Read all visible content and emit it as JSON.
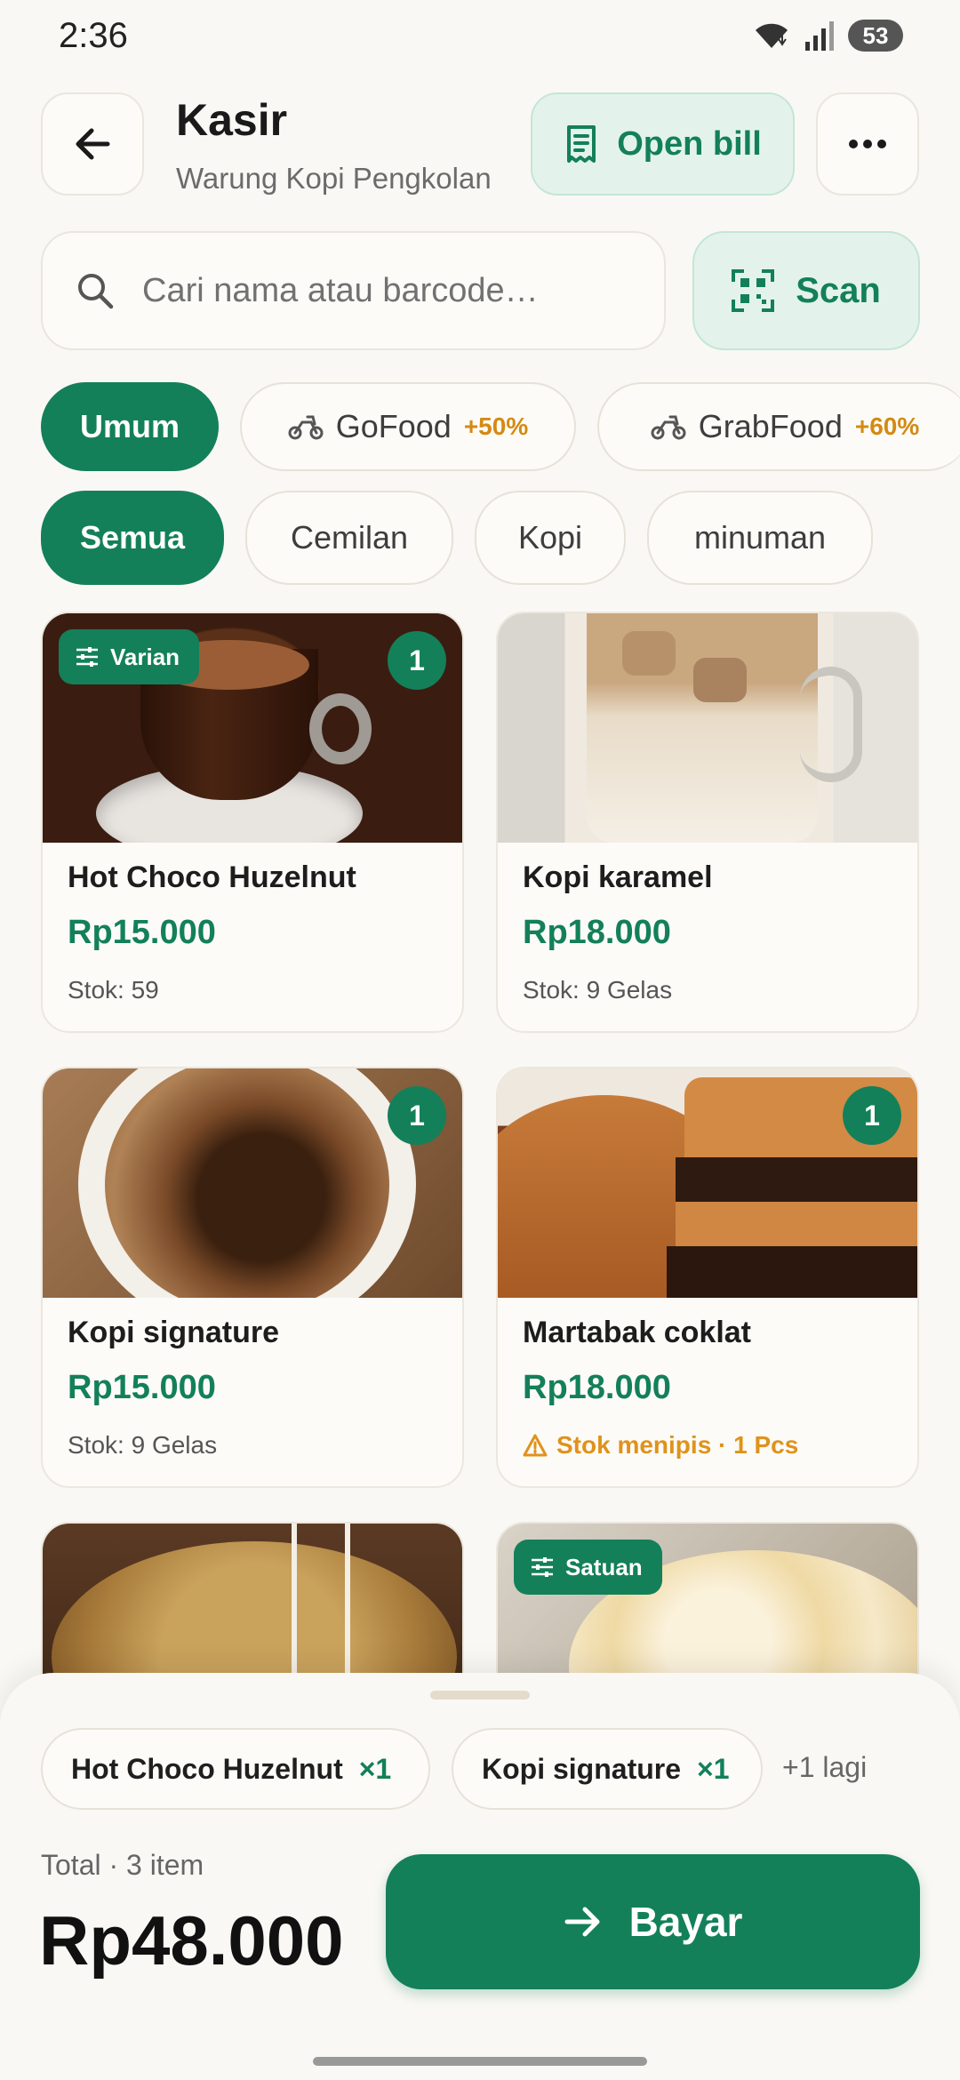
{
  "status_bar": {
    "time": "2:36",
    "battery": "53"
  },
  "header": {
    "title": "Kasir",
    "subtitle": "Warung Kopi Pengkolan",
    "open_bill_label": "Open bill"
  },
  "search": {
    "placeholder": "Cari nama atau barcode…",
    "scan_label": "Scan"
  },
  "channels": [
    {
      "label": "Umum",
      "active": true
    },
    {
      "label": "GoFood",
      "markup": "+50%"
    },
    {
      "label": "GrabFood",
      "markup": "+60%"
    }
  ],
  "categories": [
    {
      "label": "Semua",
      "active": true
    },
    {
      "label": "Cemilan"
    },
    {
      "label": "Kopi"
    },
    {
      "label": "minuman"
    }
  ],
  "products": [
    {
      "name": "Hot Choco Huzelnut",
      "price": "Rp15.000",
      "stock": "Stok: 59",
      "qty": "1",
      "badge": "Varian"
    },
    {
      "name": "Kopi karamel",
      "price": "Rp18.000",
      "stock": "Stok: 9 Gelas"
    },
    {
      "name": "Kopi signature",
      "price": "Rp15.000",
      "stock": "Stok: 9 Gelas",
      "qty": "1"
    },
    {
      "name": "Martabak coklat",
      "price": "Rp18.000",
      "stock": "Stok menipis · 1 Pcs",
      "qty": "1"
    },
    {
      "name": "",
      "price": "",
      "stock": ""
    },
    {
      "name": "",
      "price": "",
      "stock": "",
      "badge": "Satuan"
    }
  ],
  "cart": {
    "items": [
      {
        "name": "Hot Choco Huzelnut",
        "qty": "×1"
      },
      {
        "name": "Kopi signature",
        "qty": "×1"
      }
    ],
    "more": "+1 lagi",
    "total_label": "Total · 3 item",
    "total_value": "Rp48.000",
    "pay_label": "Bayar"
  },
  "colors": {
    "accent": "#13805a",
    "accent_light": "#e3f3ec",
    "warning": "#e0921a",
    "markup": "#d48a12"
  },
  "icons": [
    "arrow-left-icon",
    "receipt-icon",
    "more-horizontal-icon",
    "search-icon",
    "qr-scan-icon",
    "scooter-icon",
    "sliders-icon",
    "warning-icon",
    "arrow-right-icon",
    "wifi-icon",
    "signal-icon"
  ]
}
